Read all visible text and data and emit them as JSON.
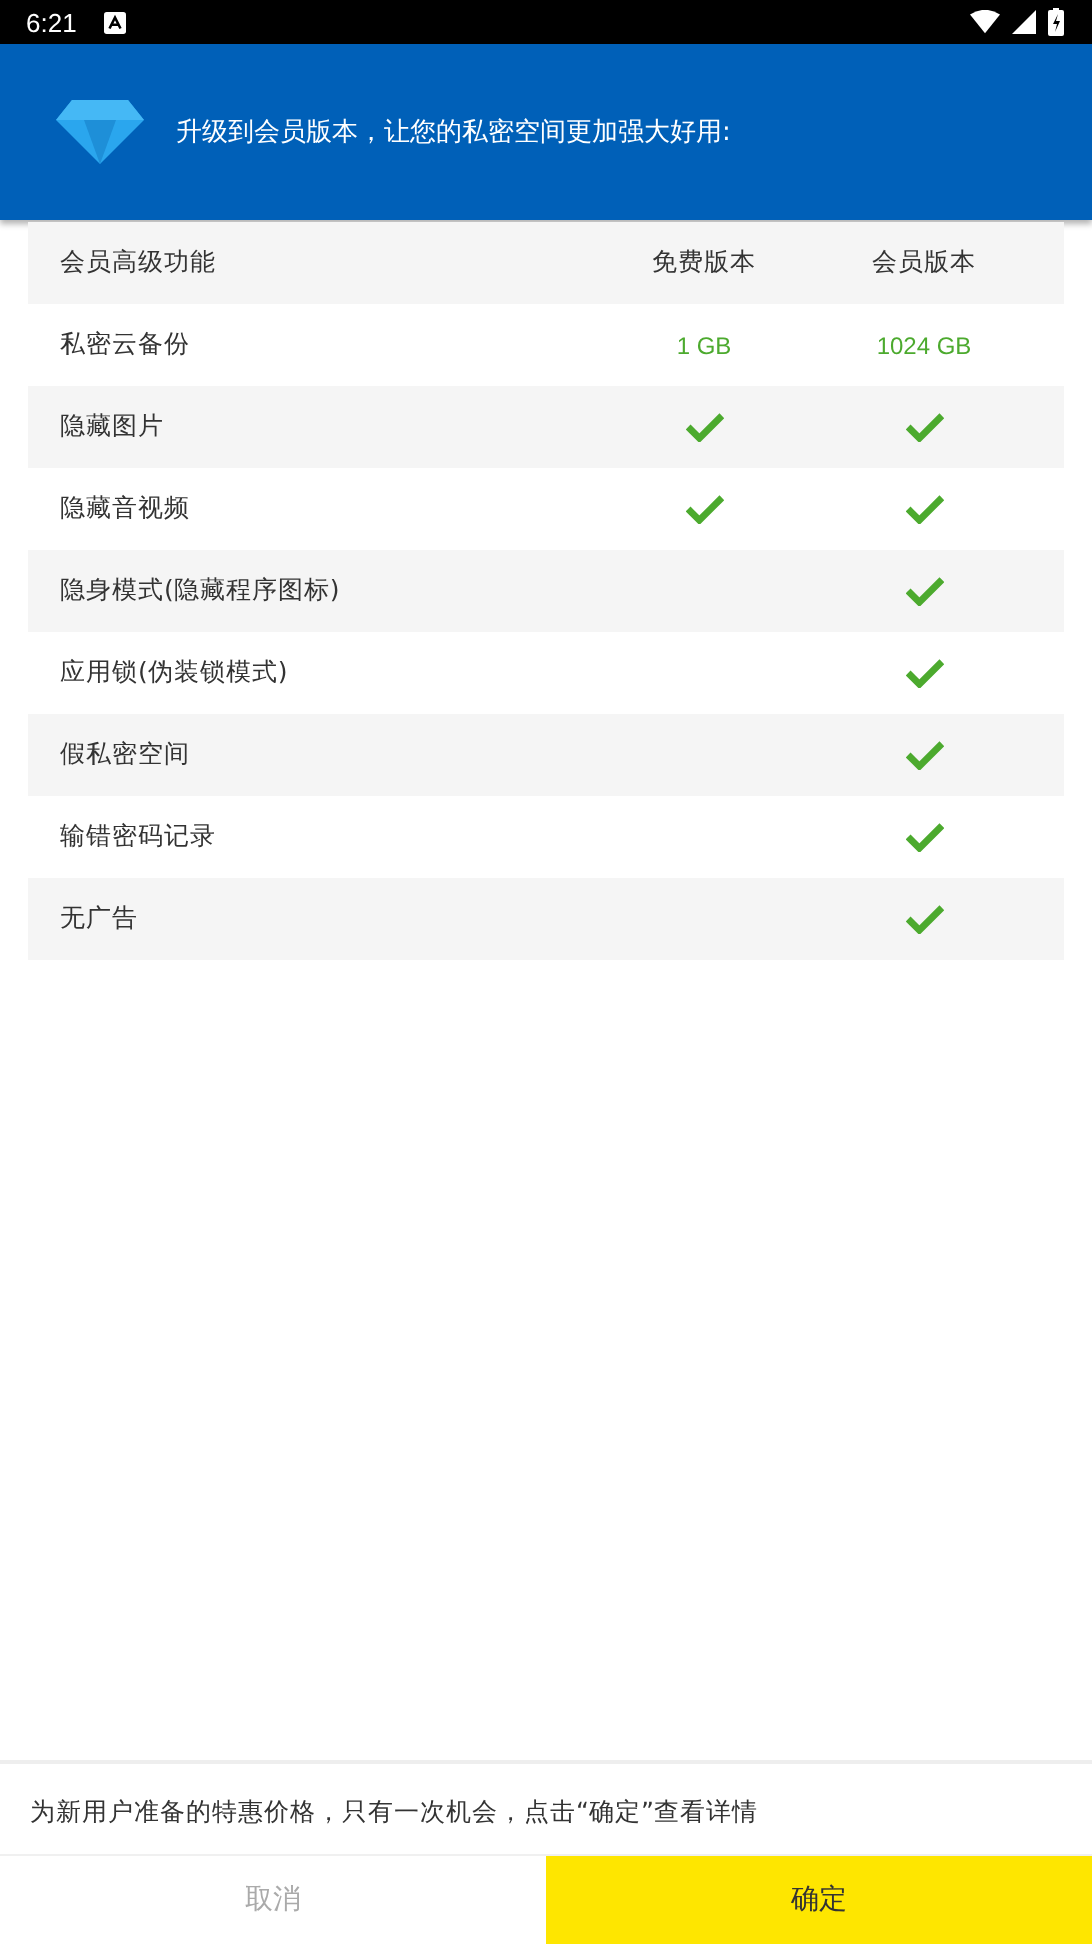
{
  "status_bar": {
    "time": "6:21"
  },
  "header": {
    "title": "升级到会员版本，让您的私密空间更加强大好用:"
  },
  "table": {
    "columns": [
      "会员高级功能",
      "免费版本",
      "会员版本"
    ],
    "rows": [
      {
        "feature": "私密云备份",
        "free": {
          "kind": "text",
          "text": "1 GB"
        },
        "member": {
          "kind": "text",
          "text": "1024 GB"
        }
      },
      {
        "feature": "隐藏图片",
        "free": {
          "kind": "check"
        },
        "member": {
          "kind": "check"
        }
      },
      {
        "feature": "隐藏音视频",
        "free": {
          "kind": "check"
        },
        "member": {
          "kind": "check"
        }
      },
      {
        "feature": "隐身模式(隐藏程序图标)",
        "free": null,
        "member": {
          "kind": "check"
        }
      },
      {
        "feature": "应用锁(伪装锁模式)",
        "free": null,
        "member": {
          "kind": "check"
        }
      },
      {
        "feature": "假私密空间",
        "free": null,
        "member": {
          "kind": "check"
        }
      },
      {
        "feature": "输错密码记录",
        "free": null,
        "member": {
          "kind": "check"
        }
      },
      {
        "feature": "无广告",
        "free": null,
        "member": {
          "kind": "check"
        }
      }
    ]
  },
  "footer": {
    "note": "为新用户准备的特惠价格，只有一次机会，点击“确定”查看详情"
  },
  "buttons": [
    {
      "label": "取消",
      "kind": "cancel"
    },
    {
      "label": "确定",
      "kind": "confirm"
    }
  ]
}
